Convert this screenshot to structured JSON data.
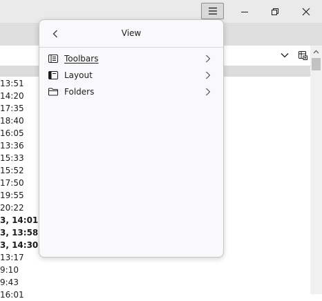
{
  "window": {
    "controls": {
      "menu_icon": "hamburger-menu-icon",
      "minimize_icon": "minimize-icon",
      "restore_icon": "restore-icon",
      "close_icon": "close-icon"
    }
  },
  "panel": {
    "title": "View",
    "back_icon": "chevron-left-icon",
    "items": [
      {
        "label": "Toolbars",
        "icon": "toolbars-icon",
        "chevron": "chevron-right-icon"
      },
      {
        "label": "Layout",
        "icon": "layout-icon",
        "chevron": "chevron-right-icon"
      },
      {
        "label": "Folders",
        "icon": "folder-icon",
        "chevron": "chevron-right-icon"
      }
    ]
  },
  "message_list": {
    "dates": [
      {
        "text": "13:51",
        "bold": false
      },
      {
        "text": "14:20",
        "bold": false
      },
      {
        "text": "17:35",
        "bold": false
      },
      {
        "text": "18:40",
        "bold": false
      },
      {
        "text": "16:05",
        "bold": false
      },
      {
        "text": "13:36",
        "bold": false
      },
      {
        "text": "15:33",
        "bold": false
      },
      {
        "text": "15:52",
        "bold": false
      },
      {
        "text": "17:50",
        "bold": false
      },
      {
        "text": "19:55",
        "bold": false
      },
      {
        "text": "20:22",
        "bold": false
      },
      {
        "text": "3, 14:01",
        "bold": true
      },
      {
        "text": "3, 13:58",
        "bold": true
      },
      {
        "text": "3, 14:30",
        "bold": true
      },
      {
        "text": "13:17",
        "bold": false
      },
      {
        "text": "9:10",
        "bold": false
      },
      {
        "text": "9:43",
        "bold": false
      },
      {
        "text": "16:01",
        "bold": false
      }
    ]
  }
}
